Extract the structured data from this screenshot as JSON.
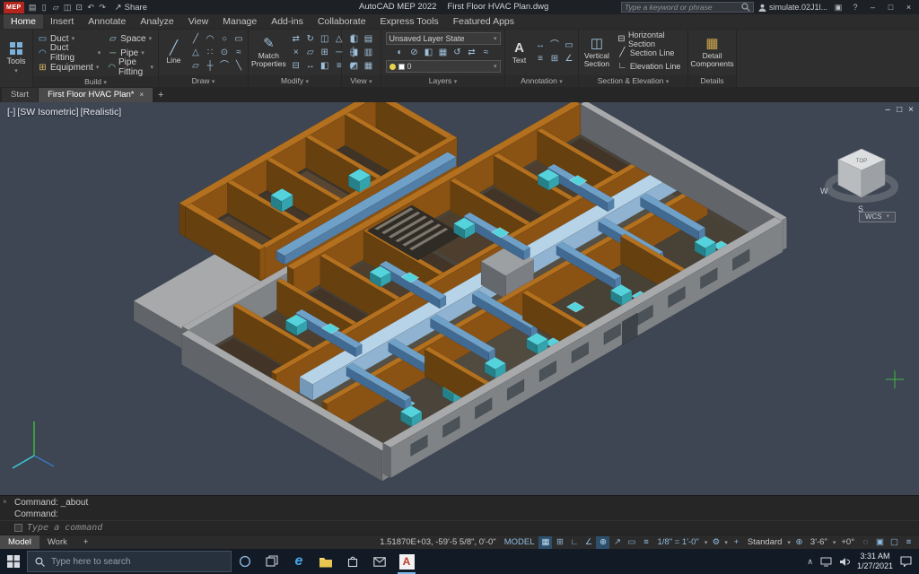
{
  "colors": {
    "viewport_bg": "#3e4654",
    "wall_brown_top": "#b3701e",
    "wall_brown_front": "#8a5213",
    "wall_brown_side": "#66400f",
    "wall_gray_top": "#a8a9ab",
    "wall_gray_front": "#808386",
    "wall_gray_side": "#616468",
    "duct_top": "#b7d3e8",
    "duct_front": "#8fb3d0",
    "duct_side": "#7398b8",
    "branch_top": "#6fa0c8",
    "branch_front": "#527fa8",
    "branch_side": "#416a92",
    "diffuser_top": "#55d3dd",
    "diffuser_front": "#33a3ad",
    "diffuser_side": "#258089",
    "equip_top": "#9da0a3",
    "equip_front": "#7b7e82",
    "equip_side": "#64676b",
    "floor_main": "#49433a",
    "floor_wing": "#3c352c",
    "floor_corridor": "#555045",
    "accent": "#0a78c8"
  },
  "icons": {
    "caret": "▾",
    "gear": "⚙",
    "plus": "+",
    "target": "⊕",
    "close": "×",
    "minimize": "–",
    "maximize": "□",
    "chevron_up": "∧",
    "share_arrow": "↗"
  },
  "titlebar": {
    "logo": "MEP",
    "quick_access": [
      {
        "name": "app-menu",
        "glyph": "▤"
      },
      {
        "name": "new-file",
        "glyph": "▯"
      },
      {
        "name": "open-file",
        "glyph": "▱"
      },
      {
        "name": "save-file",
        "glyph": "◫"
      },
      {
        "name": "plot",
        "glyph": "⊡"
      },
      {
        "name": "undo",
        "glyph": "↶"
      },
      {
        "name": "redo",
        "glyph": "↷"
      }
    ],
    "share": "Share",
    "app": "AutoCAD MEP 2022",
    "doc": "First Floor HVAC Plan.dwg",
    "search_placeholder": "Type a keyword or phrase",
    "user": "simulate.02J1l...",
    "help": "?"
  },
  "menubar": {
    "active": "Home",
    "tabs": [
      "Home",
      "Insert",
      "Annotate",
      "Analyze",
      "View",
      "Manage",
      "Add-ins",
      "Collaborate",
      "Express Tools",
      "Featured Apps"
    ]
  },
  "ribbon": {
    "tools": "Tools",
    "build": {
      "label": "Build",
      "items": [
        {
          "label": "Duct",
          "glyph": "▭",
          "color": "#7fb7e6"
        },
        {
          "label": "Duct Fitting",
          "glyph": "◠",
          "color": "#7fb7e6"
        },
        {
          "label": "Equipment",
          "glyph": "⊞",
          "color": "#d9b96a"
        },
        {
          "label": "Space",
          "glyph": "▱",
          "color": "#9ad1e8"
        },
        {
          "label": "Pipe",
          "glyph": "─",
          "color": "#8bc48b"
        },
        {
          "label": "Pipe Fitting",
          "glyph": "◠",
          "color": "#8bc48b"
        }
      ]
    },
    "draw": {
      "label": "Draw",
      "big": "Line"
    },
    "modify": {
      "label": "Modify",
      "big": "Match Properties"
    },
    "view": {
      "label": "View"
    },
    "layers": {
      "label": "Layers",
      "state": "Unsaved Layer State",
      "layer": "0"
    },
    "annotation": {
      "label": "Annotation",
      "big": "Text"
    },
    "section": {
      "label": "Section & Elevation",
      "big": "Vertical Section",
      "items": [
        {
          "label": "Horizontal Section",
          "glyph": "⊟"
        },
        {
          "label": "Section Line",
          "glyph": "╱"
        },
        {
          "label": "Elevation Line",
          "glyph": "∟"
        }
      ]
    },
    "details": {
      "label": "Details",
      "big": "Detail Components"
    }
  },
  "ribbon_icons": {
    "draw": [
      "╱",
      "◠",
      "○",
      "▭",
      "△",
      "∷",
      "⊙",
      "≈",
      "▱",
      "┼",
      "⌒",
      "╲"
    ],
    "modify": [
      "⇄",
      "↻",
      "◫",
      "△",
      "∥",
      "×",
      "▱",
      "⊞",
      "─",
      "┼",
      "⊟",
      "↔",
      "◧",
      "≡",
      "▭"
    ],
    "view": [
      "◧",
      "▤",
      "◨",
      "▥",
      "◩",
      "▦"
    ],
    "layers": [
      "◐",
      "⊘",
      "◧",
      "▦",
      "↺",
      "⇄",
      "≈"
    ],
    "annotation": [
      "↔",
      "⌒",
      "▭",
      "≡",
      "⊞",
      "∠"
    ]
  },
  "doctabs": {
    "start": "Start",
    "doc": "First Floor HVAC Plan*",
    "plus": "+"
  },
  "viewport": {
    "ctrl_minus": "[-]",
    "ctrl_view": "[SW Isometric]",
    "ctrl_style": "[Realistic]",
    "cube_top": "TOP",
    "compass_w": "W",
    "compass_s": "S",
    "wcs": "WCS"
  },
  "command": {
    "line1": "Command: _about",
    "line2": "Command:",
    "placeholder": "Type a command"
  },
  "layout_tabs": {
    "model": "Model",
    "work": "Work",
    "plus": "+"
  },
  "statusbar": {
    "coords": "1.51870E+03, -59'-5 5/8\", 0'-0\"",
    "model": "MODEL",
    "icons": [
      {
        "name": "grid-display",
        "glyph": "▦",
        "active": true
      },
      {
        "name": "snap-mode",
        "glyph": "⊞",
        "active": false
      },
      {
        "name": "ortho-mode",
        "glyph": "∟",
        "active": false
      },
      {
        "name": "polar-tracking",
        "glyph": "∠",
        "active": false
      },
      {
        "name": "object-snap",
        "glyph": "⊕",
        "active": true
      },
      {
        "name": "object-snap-tracking",
        "glyph": "↗",
        "active": false
      },
      {
        "name": "dynamic-input",
        "glyph": "▭",
        "active": false
      },
      {
        "name": "lineweight",
        "glyph": "≡",
        "active": false
      }
    ],
    "scale": "1/8\" = 1'-0\"",
    "standard": "Standard",
    "elevation": "3'-6\"",
    "angle": "+0°",
    "icons2": [
      {
        "name": "isolate-objects",
        "glyph": "◌"
      },
      {
        "name": "graphics-performance",
        "glyph": "▣"
      },
      {
        "name": "clean-screen",
        "glyph": "▢"
      },
      {
        "name": "customization",
        "glyph": "≡"
      }
    ]
  },
  "taskbar": {
    "search_placeholder": "Type here to search",
    "time": "3:31 AM",
    "date": "1/27/2021"
  }
}
